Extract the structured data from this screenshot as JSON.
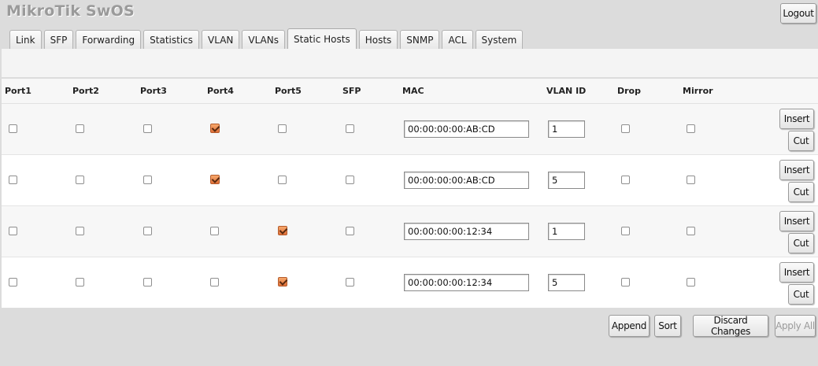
{
  "app": {
    "title": "MikroTik SwOS"
  },
  "header": {
    "logout_label": "Logout"
  },
  "tabs": [
    {
      "label": "Link",
      "active": false
    },
    {
      "label": "SFP",
      "active": false
    },
    {
      "label": "Forwarding",
      "active": false
    },
    {
      "label": "Statistics",
      "active": false
    },
    {
      "label": "VLAN",
      "active": false
    },
    {
      "label": "VLANs",
      "active": false
    },
    {
      "label": "Static Hosts",
      "active": true
    },
    {
      "label": "Hosts",
      "active": false
    },
    {
      "label": "SNMP",
      "active": false
    },
    {
      "label": "ACL",
      "active": false
    },
    {
      "label": "System",
      "active": false
    }
  ],
  "table": {
    "columns": [
      "Port1",
      "Port2",
      "Port3",
      "Port4",
      "Port5",
      "SFP",
      "MAC",
      "VLAN ID",
      "Drop",
      "Mirror"
    ],
    "rows": [
      {
        "ports": [
          false,
          false,
          false,
          true,
          false,
          false
        ],
        "mac": "00:00:00:00:AB:CD",
        "vlan_id": "1",
        "drop": false,
        "mirror": false
      },
      {
        "ports": [
          false,
          false,
          false,
          true,
          false,
          false
        ],
        "mac": "00:00:00:00:AB:CD",
        "vlan_id": "5",
        "drop": false,
        "mirror": false
      },
      {
        "ports": [
          false,
          false,
          false,
          false,
          true,
          false
        ],
        "mac": "00:00:00:00:12:34",
        "vlan_id": "1",
        "drop": false,
        "mirror": false
      },
      {
        "ports": [
          false,
          false,
          false,
          false,
          true,
          false
        ],
        "mac": "00:00:00:00:12:34",
        "vlan_id": "5",
        "drop": false,
        "mirror": false
      }
    ],
    "insert_label": "Insert",
    "cut_label": "Cut"
  },
  "footer": {
    "append_label": "Append",
    "sort_label": "Sort",
    "discard_label": "Discard Changes",
    "apply_label": "Apply All",
    "apply_enabled": false
  },
  "colors": {
    "checkbox_checked": "#e87a40",
    "title_text": "#9a9a9a"
  }
}
